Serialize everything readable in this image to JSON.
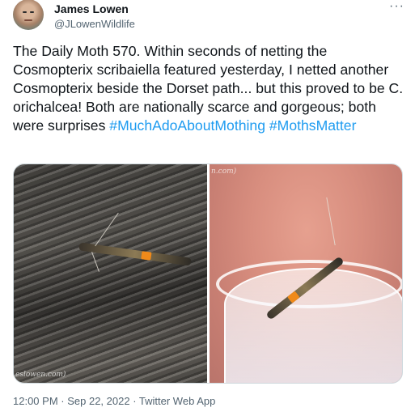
{
  "user": {
    "name": "James Lowen",
    "handle": "@JLowenWildlife"
  },
  "tweet": {
    "text_plain": "The Daily Moth 570. Within seconds of netting the Cosmopterix scribaiella featured yesterday, I netted another Cosmopterix beside the Dorset path... but this proved to be C. orichalcea! Both are nationally scarce and gorgeous; both were surprises",
    "hashtags": [
      "#MuchAdoAboutMothing",
      "#MothsMatter"
    ]
  },
  "media": {
    "left_watermark": "eslowen.com)",
    "right_watermark": "n.com)"
  },
  "footer": {
    "time": "12:00 PM",
    "sep1": " · ",
    "date": "Sep 22, 2022",
    "sep2": " · ",
    "source": "Twitter Web App"
  },
  "icons": {
    "more": "more-icon"
  },
  "colors": {
    "link": "#1d9bf0",
    "secondary": "#536471",
    "moth_spot": "#f08a1a"
  }
}
